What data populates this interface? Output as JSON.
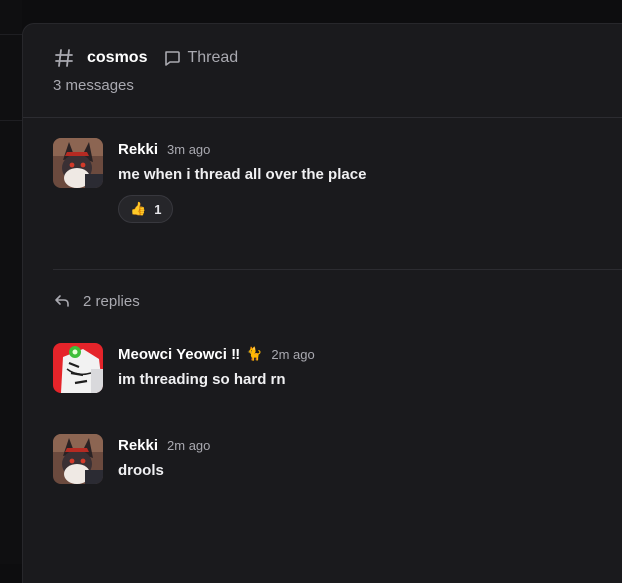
{
  "channel": {
    "name": "cosmos",
    "hash_icon": "hash-icon",
    "thread_icon": "thread-bubble-icon",
    "thread_label": "Thread",
    "message_count": "3 messages"
  },
  "root_message": {
    "author": "Rekki",
    "time": "3m ago",
    "text": "me when i thread all over the place",
    "reaction": {
      "emoji": "👍",
      "count": "1"
    }
  },
  "replies": {
    "icon": "reply-arrow-icon",
    "label": "2 replies",
    "items": [
      {
        "author": "Meowci Yeowci ‼",
        "author_emoji": "🐈",
        "time": "2m ago",
        "text": "im threading so hard rn"
      },
      {
        "author": "Rekki",
        "time": "2m ago",
        "text": "drools"
      }
    ]
  },
  "colors": {
    "panel_bg": "#1a1a1d",
    "muted_text": "#a9a9b0",
    "divider": "#2c2c31"
  }
}
